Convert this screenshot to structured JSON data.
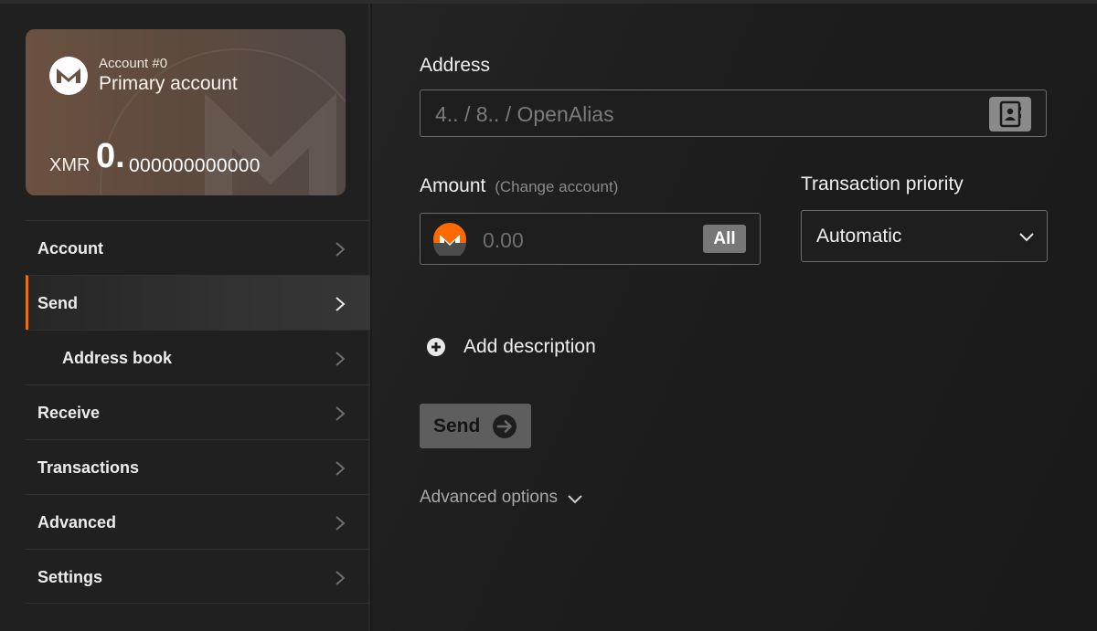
{
  "account_card": {
    "account_number": "Account #0",
    "account_name": "Primary account",
    "currency": "XMR",
    "balance_integer": "0.",
    "balance_decimal": "000000000000"
  },
  "sidebar": {
    "items": [
      {
        "label": "Account"
      },
      {
        "label": "Send"
      },
      {
        "label": "Address book"
      },
      {
        "label": "Receive"
      },
      {
        "label": "Transactions"
      },
      {
        "label": "Advanced"
      },
      {
        "label": "Settings"
      }
    ]
  },
  "send_form": {
    "address_label": "Address",
    "address_placeholder": "4.. / 8.. / OpenAlias",
    "amount_label": "Amount",
    "change_account_link": "(Change account)",
    "amount_placeholder": "0.00",
    "all_button": "All",
    "priority_label": "Transaction priority",
    "priority_value": "Automatic",
    "add_description": "Add description",
    "send_button": "Send",
    "advanced_options": "Advanced options"
  },
  "colors": {
    "accent": "#ff6a00",
    "background": "#1a1a1a",
    "sidebar": "#202020",
    "card_brown": "#6b5141"
  },
  "icons": {
    "monero_logo": "monero-logo-icon",
    "address_book": "address-book-icon",
    "xmr_coin": "xmr-coin-icon",
    "chevron": "chevron-right-icon",
    "dropdown": "chevron-down-icon",
    "plus": "plus-circle-icon",
    "arrow": "arrow-right-circle-icon"
  }
}
